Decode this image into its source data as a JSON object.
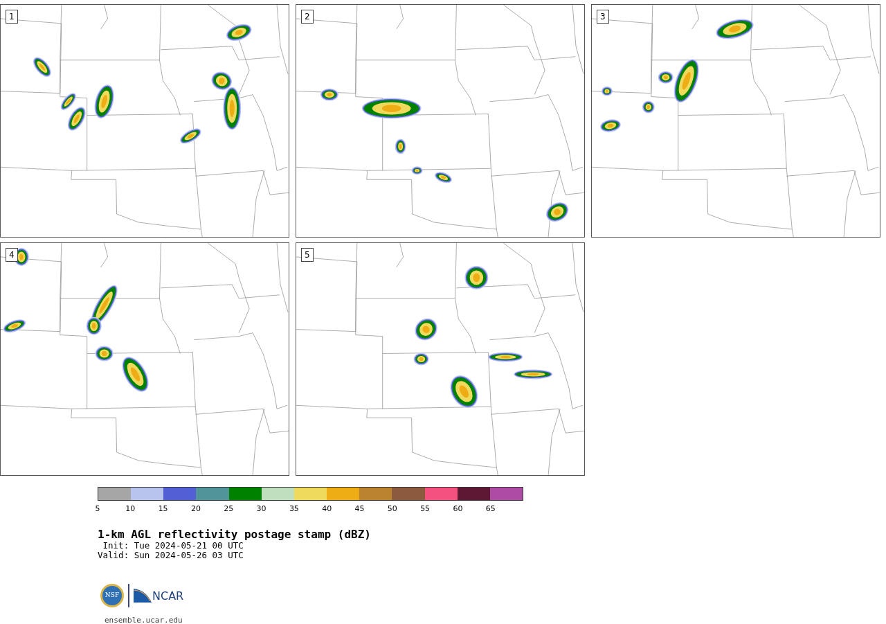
{
  "maps": [
    {
      "label": "1"
    },
    {
      "label": "2"
    },
    {
      "label": "3"
    },
    {
      "label": "4"
    },
    {
      "label": "5"
    }
  ],
  "colorbar": {
    "bins": [
      {
        "color": "#a6a6a6"
      },
      {
        "color": "#b8c4ee"
      },
      {
        "color": "#525fd5"
      },
      {
        "color": "#519599"
      },
      {
        "color": "#008100"
      },
      {
        "color": "#bfdfbf"
      },
      {
        "color": "#efda5e"
      },
      {
        "color": "#efad15"
      },
      {
        "color": "#bb8230"
      },
      {
        "color": "#8c5a3c"
      },
      {
        "color": "#f55180"
      },
      {
        "color": "#5e1834"
      },
      {
        "color": "#ae4ba5"
      }
    ],
    "ticks": [
      "5",
      "10",
      "15",
      "20",
      "25",
      "30",
      "35",
      "40",
      "45",
      "50",
      "55",
      "60",
      "65"
    ]
  },
  "title": "1-km AGL reflectivity postage stamp (dBZ)",
  "init": " Init: Tue 2024-05-21 00 UTC",
  "valid": "Valid: Sun 2024-05-26 03 UTC",
  "logos": {
    "nsf": "NSF",
    "ncar": "NCAR"
  },
  "url": "ensemble.ucar.edu"
}
